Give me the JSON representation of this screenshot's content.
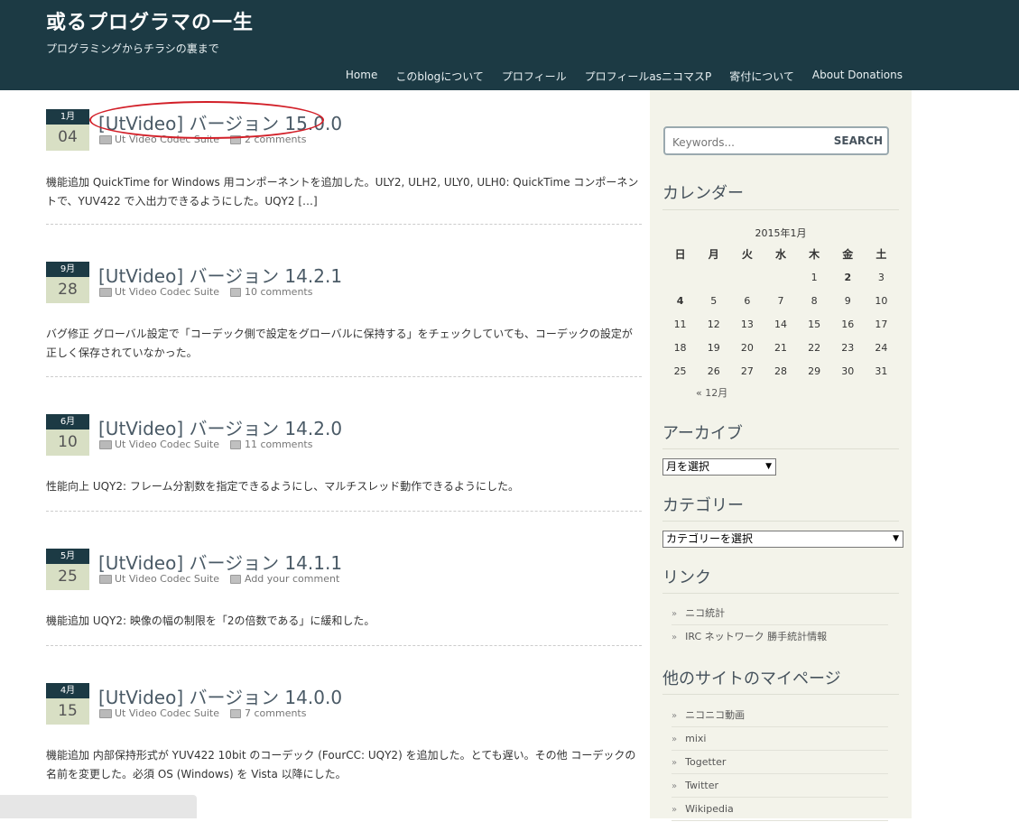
{
  "header": {
    "site_title": "或るプログラマの一生",
    "tagline": "プログラミングからチラシの裏まで",
    "nav": [
      "Home",
      "このblogについて",
      "プロフィール",
      "プロフィールasニコマスP",
      "寄付について",
      "About Donations"
    ]
  },
  "posts": [
    {
      "month": "1月",
      "day": "04",
      "title": "[UtVideo] バージョン 15.0.0",
      "category": "Ut Video Codec Suite",
      "comments": "2 comments",
      "excerpt": "機能追加 QuickTime for Windows 用コンポーネントを追加した。ULY2, ULH2, ULY0, ULH0: QuickTime コンポーネントで、YUV422 で入出力できるようにした。UQY2 […]"
    },
    {
      "month": "9月",
      "day": "28",
      "title": "[UtVideo] バージョン 14.2.1",
      "category": "Ut Video Codec Suite",
      "comments": "10 comments",
      "excerpt": "バグ修正 グローバル設定で「コーデック側で設定をグローバルに保持する」をチェックしていても、コーデックの設定が正しく保存されていなかった。"
    },
    {
      "month": "6月",
      "day": "10",
      "title": "[UtVideo] バージョン 14.2.0",
      "category": "Ut Video Codec Suite",
      "comments": "11 comments",
      "excerpt": "性能向上 UQY2: フレーム分割数を指定できるようにし、マルチスレッド動作できるようにした。"
    },
    {
      "month": "5月",
      "day": "25",
      "title": "[UtVideo] バージョン 14.1.1",
      "category": "Ut Video Codec Suite",
      "comments": "Add your comment",
      "excerpt": "機能追加 UQY2: 映像の幅の制限を「2の倍数である」に緩和した。"
    },
    {
      "month": "4月",
      "day": "15",
      "title": "[UtVideo] バージョン 14.0.0",
      "category": "Ut Video Codec Suite",
      "comments": "7 comments",
      "excerpt": "機能追加 内部保持形式が YUV422 10bit のコーデック (FourCC: UQY2) を追加した。とても遅い。その他 コーデックの名前を変更した。必須 OS (Windows) を Vista 以降にした。"
    }
  ],
  "sidebar": {
    "search_placeholder": "Keywords...",
    "search_button": "SEARCH",
    "calendar": {
      "title": "カレンダー",
      "caption": "2015年1月",
      "weekdays": [
        "日",
        "月",
        "火",
        "水",
        "木",
        "金",
        "土"
      ],
      "weeks": [
        [
          "",
          "",
          "",
          "",
          "1",
          "2",
          "3"
        ],
        [
          "4",
          "5",
          "6",
          "7",
          "8",
          "9",
          "10"
        ],
        [
          "11",
          "12",
          "13",
          "14",
          "15",
          "16",
          "17"
        ],
        [
          "18",
          "19",
          "20",
          "21",
          "22",
          "23",
          "24"
        ],
        [
          "25",
          "26",
          "27",
          "28",
          "29",
          "30",
          "31"
        ]
      ],
      "prev_link": "« 12月"
    },
    "archive": {
      "title": "アーカイブ",
      "select_value": "月を選択"
    },
    "categories": {
      "title": "カテゴリー",
      "select_value": "カテゴリーを選択"
    },
    "links": {
      "title": "リンク",
      "items": [
        "ニコ統計",
        "IRC ネットワーク 勝手統計情報"
      ]
    },
    "mypages": {
      "title": "他のサイトのマイページ",
      "items": [
        "ニコニコ動画",
        "mixi",
        "Togetter",
        "Twitter",
        "Wikipedia"
      ]
    },
    "bullet": "»"
  },
  "colors": {
    "header_bg": "#1c3a44",
    "highlight": "#d21f28",
    "sidebar_bg": "#f3f3ea"
  }
}
